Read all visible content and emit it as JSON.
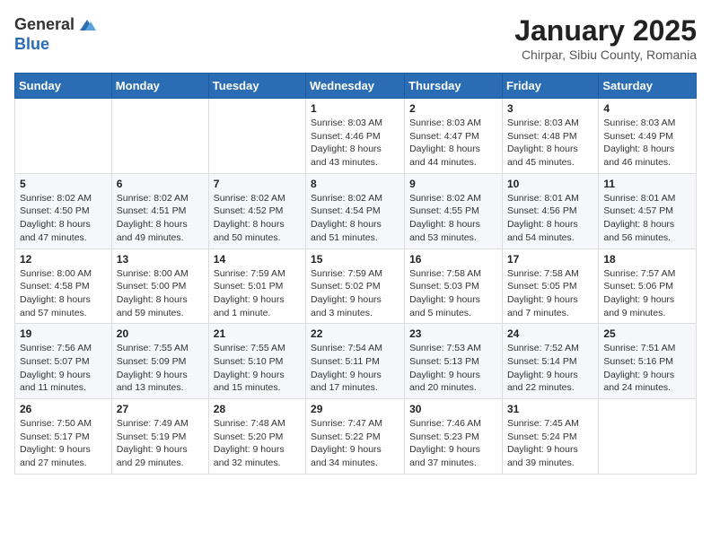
{
  "logo": {
    "general": "General",
    "blue": "Blue"
  },
  "title": "January 2025",
  "location": "Chirpar, Sibiu County, Romania",
  "weekdays": [
    "Sunday",
    "Monday",
    "Tuesday",
    "Wednesday",
    "Thursday",
    "Friday",
    "Saturday"
  ],
  "weeks": [
    [
      {
        "day": "",
        "text": ""
      },
      {
        "day": "",
        "text": ""
      },
      {
        "day": "",
        "text": ""
      },
      {
        "day": "1",
        "text": "Sunrise: 8:03 AM\nSunset: 4:46 PM\nDaylight: 8 hours and 43 minutes."
      },
      {
        "day": "2",
        "text": "Sunrise: 8:03 AM\nSunset: 4:47 PM\nDaylight: 8 hours and 44 minutes."
      },
      {
        "day": "3",
        "text": "Sunrise: 8:03 AM\nSunset: 4:48 PM\nDaylight: 8 hours and 45 minutes."
      },
      {
        "day": "4",
        "text": "Sunrise: 8:03 AM\nSunset: 4:49 PM\nDaylight: 8 hours and 46 minutes."
      }
    ],
    [
      {
        "day": "5",
        "text": "Sunrise: 8:02 AM\nSunset: 4:50 PM\nDaylight: 8 hours and 47 minutes."
      },
      {
        "day": "6",
        "text": "Sunrise: 8:02 AM\nSunset: 4:51 PM\nDaylight: 8 hours and 49 minutes."
      },
      {
        "day": "7",
        "text": "Sunrise: 8:02 AM\nSunset: 4:52 PM\nDaylight: 8 hours and 50 minutes."
      },
      {
        "day": "8",
        "text": "Sunrise: 8:02 AM\nSunset: 4:54 PM\nDaylight: 8 hours and 51 minutes."
      },
      {
        "day": "9",
        "text": "Sunrise: 8:02 AM\nSunset: 4:55 PM\nDaylight: 8 hours and 53 minutes."
      },
      {
        "day": "10",
        "text": "Sunrise: 8:01 AM\nSunset: 4:56 PM\nDaylight: 8 hours and 54 minutes."
      },
      {
        "day": "11",
        "text": "Sunrise: 8:01 AM\nSunset: 4:57 PM\nDaylight: 8 hours and 56 minutes."
      }
    ],
    [
      {
        "day": "12",
        "text": "Sunrise: 8:00 AM\nSunset: 4:58 PM\nDaylight: 8 hours and 57 minutes."
      },
      {
        "day": "13",
        "text": "Sunrise: 8:00 AM\nSunset: 5:00 PM\nDaylight: 8 hours and 59 minutes."
      },
      {
        "day": "14",
        "text": "Sunrise: 7:59 AM\nSunset: 5:01 PM\nDaylight: 9 hours and 1 minute."
      },
      {
        "day": "15",
        "text": "Sunrise: 7:59 AM\nSunset: 5:02 PM\nDaylight: 9 hours and 3 minutes."
      },
      {
        "day": "16",
        "text": "Sunrise: 7:58 AM\nSunset: 5:03 PM\nDaylight: 9 hours and 5 minutes."
      },
      {
        "day": "17",
        "text": "Sunrise: 7:58 AM\nSunset: 5:05 PM\nDaylight: 9 hours and 7 minutes."
      },
      {
        "day": "18",
        "text": "Sunrise: 7:57 AM\nSunset: 5:06 PM\nDaylight: 9 hours and 9 minutes."
      }
    ],
    [
      {
        "day": "19",
        "text": "Sunrise: 7:56 AM\nSunset: 5:07 PM\nDaylight: 9 hours and 11 minutes."
      },
      {
        "day": "20",
        "text": "Sunrise: 7:55 AM\nSunset: 5:09 PM\nDaylight: 9 hours and 13 minutes."
      },
      {
        "day": "21",
        "text": "Sunrise: 7:55 AM\nSunset: 5:10 PM\nDaylight: 9 hours and 15 minutes."
      },
      {
        "day": "22",
        "text": "Sunrise: 7:54 AM\nSunset: 5:11 PM\nDaylight: 9 hours and 17 minutes."
      },
      {
        "day": "23",
        "text": "Sunrise: 7:53 AM\nSunset: 5:13 PM\nDaylight: 9 hours and 20 minutes."
      },
      {
        "day": "24",
        "text": "Sunrise: 7:52 AM\nSunset: 5:14 PM\nDaylight: 9 hours and 22 minutes."
      },
      {
        "day": "25",
        "text": "Sunrise: 7:51 AM\nSunset: 5:16 PM\nDaylight: 9 hours and 24 minutes."
      }
    ],
    [
      {
        "day": "26",
        "text": "Sunrise: 7:50 AM\nSunset: 5:17 PM\nDaylight: 9 hours and 27 minutes."
      },
      {
        "day": "27",
        "text": "Sunrise: 7:49 AM\nSunset: 5:19 PM\nDaylight: 9 hours and 29 minutes."
      },
      {
        "day": "28",
        "text": "Sunrise: 7:48 AM\nSunset: 5:20 PM\nDaylight: 9 hours and 32 minutes."
      },
      {
        "day": "29",
        "text": "Sunrise: 7:47 AM\nSunset: 5:22 PM\nDaylight: 9 hours and 34 minutes."
      },
      {
        "day": "30",
        "text": "Sunrise: 7:46 AM\nSunset: 5:23 PM\nDaylight: 9 hours and 37 minutes."
      },
      {
        "day": "31",
        "text": "Sunrise: 7:45 AM\nSunset: 5:24 PM\nDaylight: 9 hours and 39 minutes."
      },
      {
        "day": "",
        "text": ""
      }
    ]
  ]
}
